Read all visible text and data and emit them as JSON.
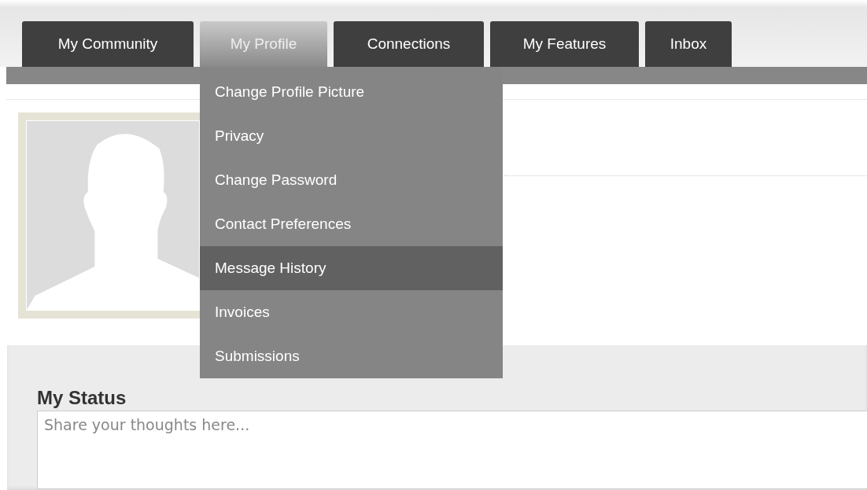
{
  "tabs": [
    {
      "label": "My Community",
      "selected": false
    },
    {
      "label": "My Profile",
      "selected": true
    },
    {
      "label": "Connections",
      "selected": false
    },
    {
      "label": "My Features",
      "selected": false
    },
    {
      "label": "Inbox",
      "selected": false
    }
  ],
  "dropdown": {
    "items": [
      {
        "label": "Change Profile Picture",
        "selected": false
      },
      {
        "label": "Privacy",
        "selected": false
      },
      {
        "label": "Change Password",
        "selected": false
      },
      {
        "label": "Contact Preferences",
        "selected": false
      },
      {
        "label": "Message History",
        "selected": true
      },
      {
        "label": "Invoices",
        "selected": false
      },
      {
        "label": "Submissions",
        "selected": false
      }
    ]
  },
  "status": {
    "heading": "My Status",
    "placeholder": "Share your thoughts here..."
  }
}
